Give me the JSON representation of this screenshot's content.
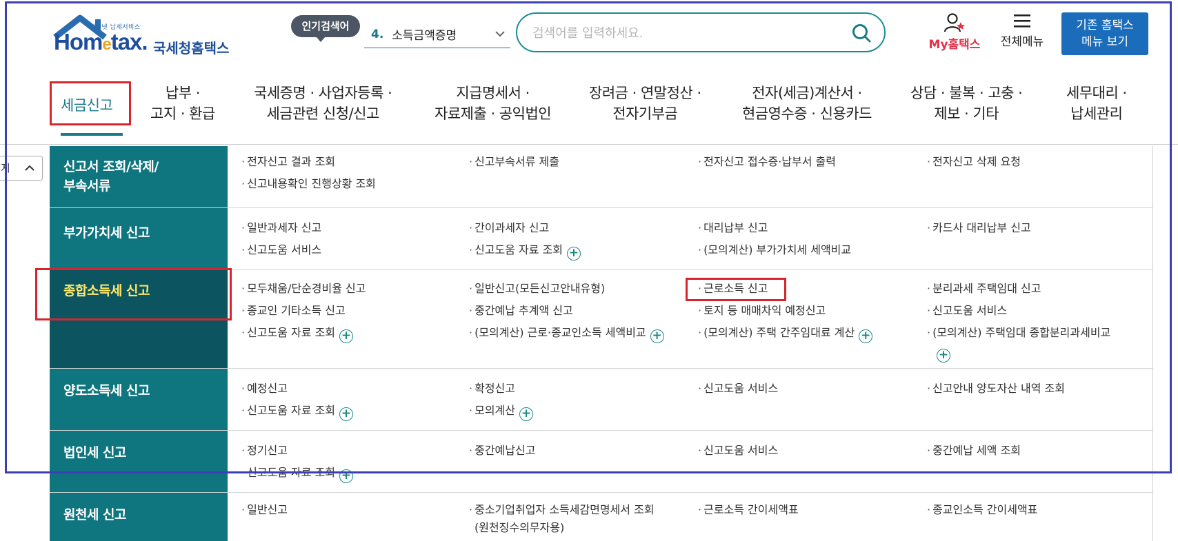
{
  "header": {
    "logo_small_tag": "인터넷 납세서비스",
    "logo_brand_prefix": "Hom",
    "logo_brand_e": "e",
    "logo_brand_suffix": "tax.",
    "logo_kr": "국세청홈택스",
    "popular_tag": "인기검색어",
    "popular_rank": "4.",
    "popular_term": "소득금액증명",
    "search_placeholder": "검색어를 입력하세요.",
    "my_hometax": "My홈택스",
    "all_menu": "전체메뉴",
    "old_menu_line1": "기존 홈택스",
    "old_menu_line2": "메뉴 보기"
  },
  "gnb": {
    "items": [
      {
        "line1": "세금신고",
        "line2": ""
      },
      {
        "line1": "납부 ·",
        "line2": "고지 · 환급"
      },
      {
        "line1": "국세증명 · 사업자등록 ·",
        "line2": "세금관련 신청/신고"
      },
      {
        "line1": "지급명세서 ·",
        "line2": "자료제출 · 공익법인"
      },
      {
        "line1": "장려금 · 연말정산 ·",
        "line2": "전자기부금"
      },
      {
        "line1": "전자(세금)계산서 ·",
        "line2": "현금영수증 · 신용카드"
      },
      {
        "line1": "상담 · 불복 · 고충 ·",
        "line2": "제보 · 기타"
      },
      {
        "line1": "세무대리 ·",
        "line2": "납세관리"
      }
    ]
  },
  "side_tab": {
    "label": "지"
  },
  "mega_menu": {
    "rows": [
      {
        "category_line1": "신고서 조회/삭제/",
        "category_line2": "부속서류",
        "items": [
          "전자신고 결과 조회",
          "신고부속서류 제출",
          "전자신고 접수증·납부서 출력",
          "전자신고 삭제 요청",
          "신고내용확인 진행상황 조회"
        ]
      },
      {
        "category_line1": "부가가치세 신고",
        "items": [
          "일반과세자 신고",
          "간이과세자 신고",
          "대리납부 신고",
          "카드사 대리납부 신고",
          "신고도움 서비스",
          "신고도움 자료 조회",
          "(모의계산) 부가가치세 세액비교"
        ]
      },
      {
        "category_line1": "종합소득세 신고",
        "items": [
          "모두채움/단순경비율 신고",
          "일반신고(모든신고안내유형)",
          "근로소득 신고",
          "분리과세 주택임대 신고",
          "종교인 기타소득 신고",
          "중간예납 추계액 신고",
          "토지 등 매매차익 예정신고",
          "신고도움 서비스",
          "신고도움 자료 조회",
          "(모의계산) 근로·종교인소득 세액비교",
          "(모의계산) 주택 간주임대료 계산",
          "(모의계산) 주택임대 종합분리과세비교"
        ]
      },
      {
        "category_line1": "양도소득세 신고",
        "items": [
          "예정신고",
          "확정신고",
          "신고도움 서비스",
          "신고안내 양도자산 내역 조회",
          "신고도움 자료 조회",
          "모의계산"
        ]
      },
      {
        "category_line1": "법인세 신고",
        "items": [
          "정기신고",
          "중간예납신고",
          "신고도움 서비스",
          "중간예납 세액 조회",
          "신고도움 자료 조회"
        ]
      },
      {
        "category_line1": "원천세 신고",
        "items": [
          "일반신고",
          "중소기업취업자 소득세감면명세서 조회",
          "(원천징수의무자용)",
          "근로소득 간이세액표",
          "종교인소득 간이세액표"
        ]
      }
    ]
  },
  "colors": {
    "teal": "#0f7680",
    "teal_active": "#0c5560",
    "active_text": "#ffe866",
    "highlight_red": "#d9232d",
    "outline_blue": "#3b3fb3",
    "button_blue": "#1b6cba"
  }
}
